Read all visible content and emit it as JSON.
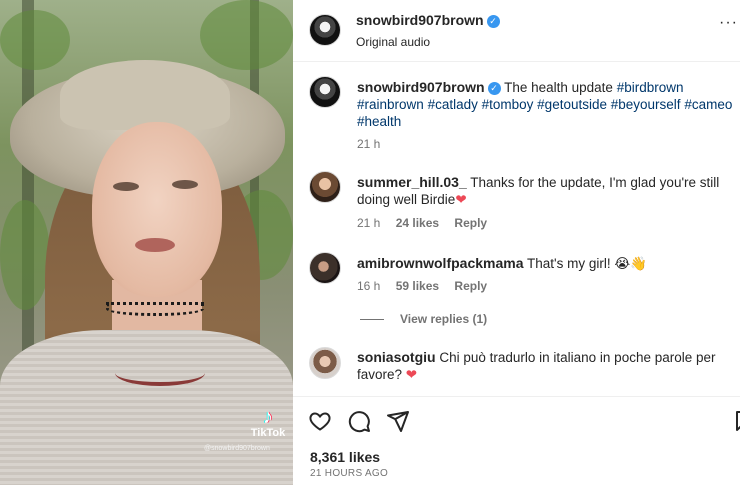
{
  "media": {
    "watermark_brand": "TikTok",
    "watermark_handle": "@snowbird907brown"
  },
  "header": {
    "username": "snowbird907brown",
    "subtitle": "Original audio",
    "more_icon": "more-horizontal-icon"
  },
  "caption": {
    "username": "snowbird907brown",
    "text": "The health update",
    "hashtags": [
      "#birdbrown",
      "#rainbrown",
      "#catlady",
      "#tomboy",
      "#getoutside",
      "#beyourself",
      "#cameo",
      "#health"
    ],
    "time": "21 h"
  },
  "comments": [
    {
      "username": "summer_hill.03_",
      "text": "Thanks for the update, I'm glad you're still doing well Birdie",
      "emoji": "❤",
      "time": "21 h",
      "likes": "24 likes",
      "reply": "Reply"
    },
    {
      "username": "amibrownwolfpackmama",
      "text": "That's my girl!",
      "emoji": "😭👋",
      "time": "16 h",
      "likes": "59 likes",
      "reply": "Reply",
      "view_replies": "View replies (1)"
    },
    {
      "username": "soniasotgiu",
      "text": "Chi può tradurlo in italiano in poche parole per favore?",
      "emoji": "❤"
    }
  ],
  "footer": {
    "likes": "8,361 likes",
    "time_ago": "21 HOURS AGO"
  },
  "colors": {
    "verified": "#3897f0",
    "hashtag": "#00376b",
    "heart": "#ed4956",
    "secondary_text": "#737373"
  }
}
